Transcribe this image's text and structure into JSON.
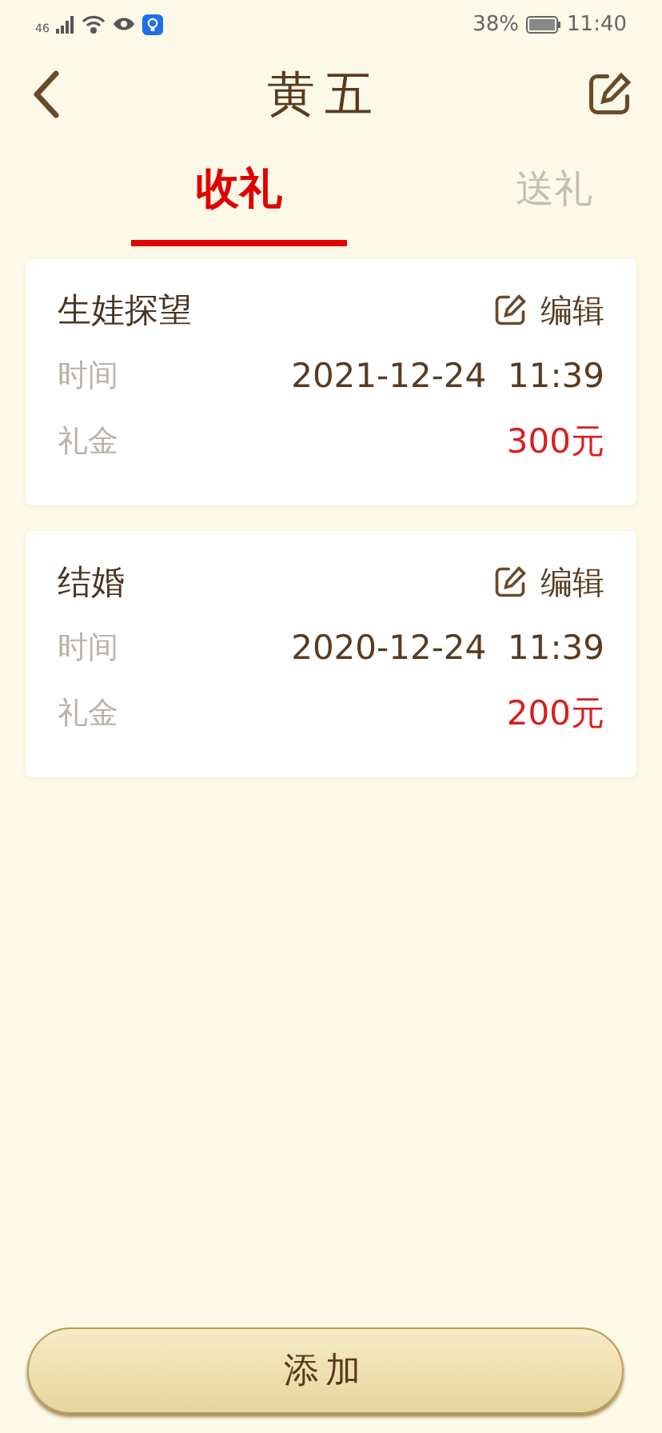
{
  "status_bar": {
    "network": "46",
    "battery": "38%",
    "time": "11:40"
  },
  "header": {
    "title": "黄五"
  },
  "tabs": [
    {
      "label": "收礼",
      "selected": true
    },
    {
      "label": "送礼",
      "selected": false
    }
  ],
  "records": [
    {
      "title": "生娃探望",
      "edit": "编辑",
      "time_label": "时间",
      "time": "2021-12-24  11:39",
      "amount_label": "礼金",
      "amount": "300元"
    },
    {
      "title": "结婚",
      "edit": "编辑",
      "time_label": "时间",
      "time": "2020-12-24  11:39",
      "amount_label": "礼金",
      "amount": "200元"
    }
  ],
  "add_button": "添加"
}
